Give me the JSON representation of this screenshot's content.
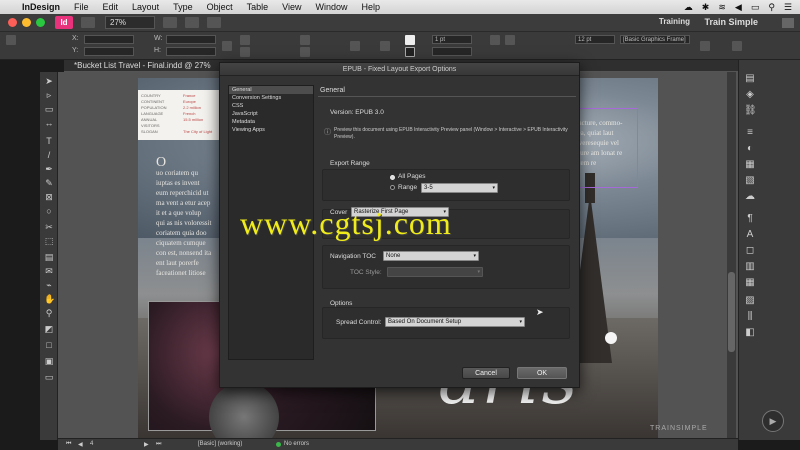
{
  "menubar": {
    "app": "InDesign",
    "items": [
      "File",
      "Edit",
      "Layout",
      "Type",
      "Object",
      "Table",
      "View",
      "Window",
      "Help"
    ]
  },
  "appbar": {
    "zoom": "27%",
    "workspace": "Training",
    "brand_user": "Train Simple"
  },
  "control": {
    "x_label": "X:",
    "y_label": "Y:",
    "w_label": "W:",
    "h_label": "H:",
    "stroke": "1 pt",
    "stroke_pt": "12 pt",
    "frame_style": "[Basic Graphics Frame]"
  },
  "document": {
    "tab_title": "*Bucket List Travel - Final.indd @ 27%"
  },
  "page": {
    "info_rows": [
      {
        "k": "COUNTRY",
        "v": "France"
      },
      {
        "k": "CONTINENT",
        "v": "Europe"
      },
      {
        "k": "POPULATION",
        "v": "2.2 million"
      },
      {
        "k": "LANGUAGE",
        "v": "French"
      },
      {
        "k": "ANNUAL VISITORS",
        "v": "15.5 million"
      },
      {
        "k": "SLOGAN",
        "v": "The City of Light"
      }
    ],
    "body_lines": [
      "O",
      "uo coriatem qu",
      "iuptas es invent",
      "eum reperchicid ut",
      "ma vent a etur acep",
      "it et a que volup",
      "qui as nis voloressit",
      "coriatem quia doo",
      "ciquatem cumque",
      "con est, nonsend ita",
      "ent laut porerfe",
      "faceationet litiose"
    ],
    "right_lines": [
      "iumquam facture, commo-",
      "ura venis rea, quiat laut",
      "il te oil nit veresequie vel",
      "oyte ut. Itature am lonat re",
      "odellibus atem re",
      "do dolor!"
    ],
    "title_word": "aris",
    "brand": "TRAINSIMPLE"
  },
  "dialog": {
    "title": "EPUB - Fixed Layout Export Options",
    "nav": [
      "General",
      "Conversion Settings",
      "CSS",
      "JavaScript",
      "Metadata",
      "Viewing Apps"
    ],
    "section": "General",
    "version": "Version: EPUB 3.0",
    "info": "Preview this document using EPUB Interactivity Preview panel (Window > Interactive > EPUB Interactivity Preview).",
    "export_range": {
      "title": "Export Range",
      "all_pages": "All Pages",
      "range": "Range",
      "range_value": "3-5"
    },
    "cover": {
      "label": "Cover",
      "value": "Rasterize First Page"
    },
    "navigation": {
      "label": "Navigation TOC",
      "value": "None",
      "toc_style": "TOC Style:"
    },
    "options": {
      "title": "Options",
      "spread_label": "Spread Control:",
      "spread_value": "Based On Document Setup"
    },
    "cancel": "Cancel",
    "ok": "OK"
  },
  "watermark": "www.cgtsj.com",
  "status": {
    "page": "4",
    "style": "[Basic] (working)",
    "errors": "No errors"
  },
  "colors": {
    "accent": "#a66ad8",
    "watermark": "#f0ec1a",
    "ok_status": "#3bb84a"
  }
}
